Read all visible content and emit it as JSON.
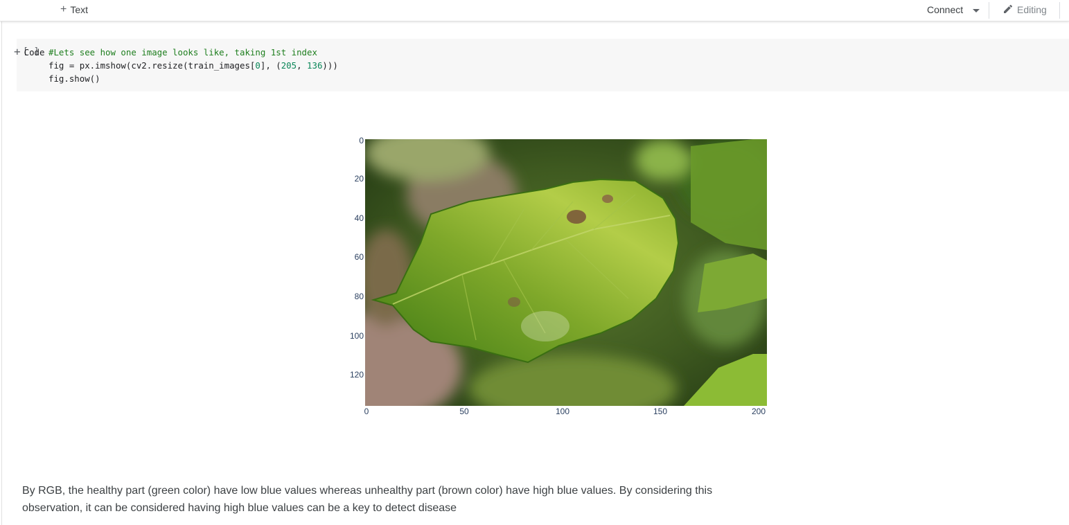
{
  "toolbar": {
    "code_label": "Code",
    "text_label": "Text",
    "connect_label": "Connect",
    "editing_label": "Editing",
    "icons": [
      "plus-icon",
      "chevron-down-icon",
      "pencil-icon"
    ]
  },
  "cell": {
    "run_label": "[ ]",
    "code_line_1": "#Lets see how one image looks like, taking 1st index",
    "code_line_2_a": "fig = px.imshow(cv2.resize(train_images[",
    "code_line_2_idx": "0",
    "code_line_2_b": "], (",
    "code_line_2_w": "205",
    "code_line_2_sep": ", ",
    "code_line_2_h": "136",
    "code_line_2_c": ")))",
    "code_line_3": "fig.show()"
  },
  "chart_data": {
    "type": "image",
    "x_ticks": [
      "0",
      "50",
      "100",
      "150",
      "200"
    ],
    "y_ticks": [
      "0",
      "20",
      "40",
      "60",
      "80",
      "100",
      "120"
    ],
    "xlim": [
      0,
      205
    ],
    "ylim": [
      136,
      0
    ],
    "image_description_colors": {
      "leaf_green": "#6c9b1c",
      "leaf_light": "#b6cf45",
      "background_dark": "#2f4a1a",
      "background_pink": "#9c7d70"
    }
  },
  "markdown": {
    "text": "By RGB, the healthy part (green color) have low blue values whereas unhealthy part (brown color) have high blue values. By considering this observation, it can be considered having high blue values can be a key to detect disease"
  }
}
